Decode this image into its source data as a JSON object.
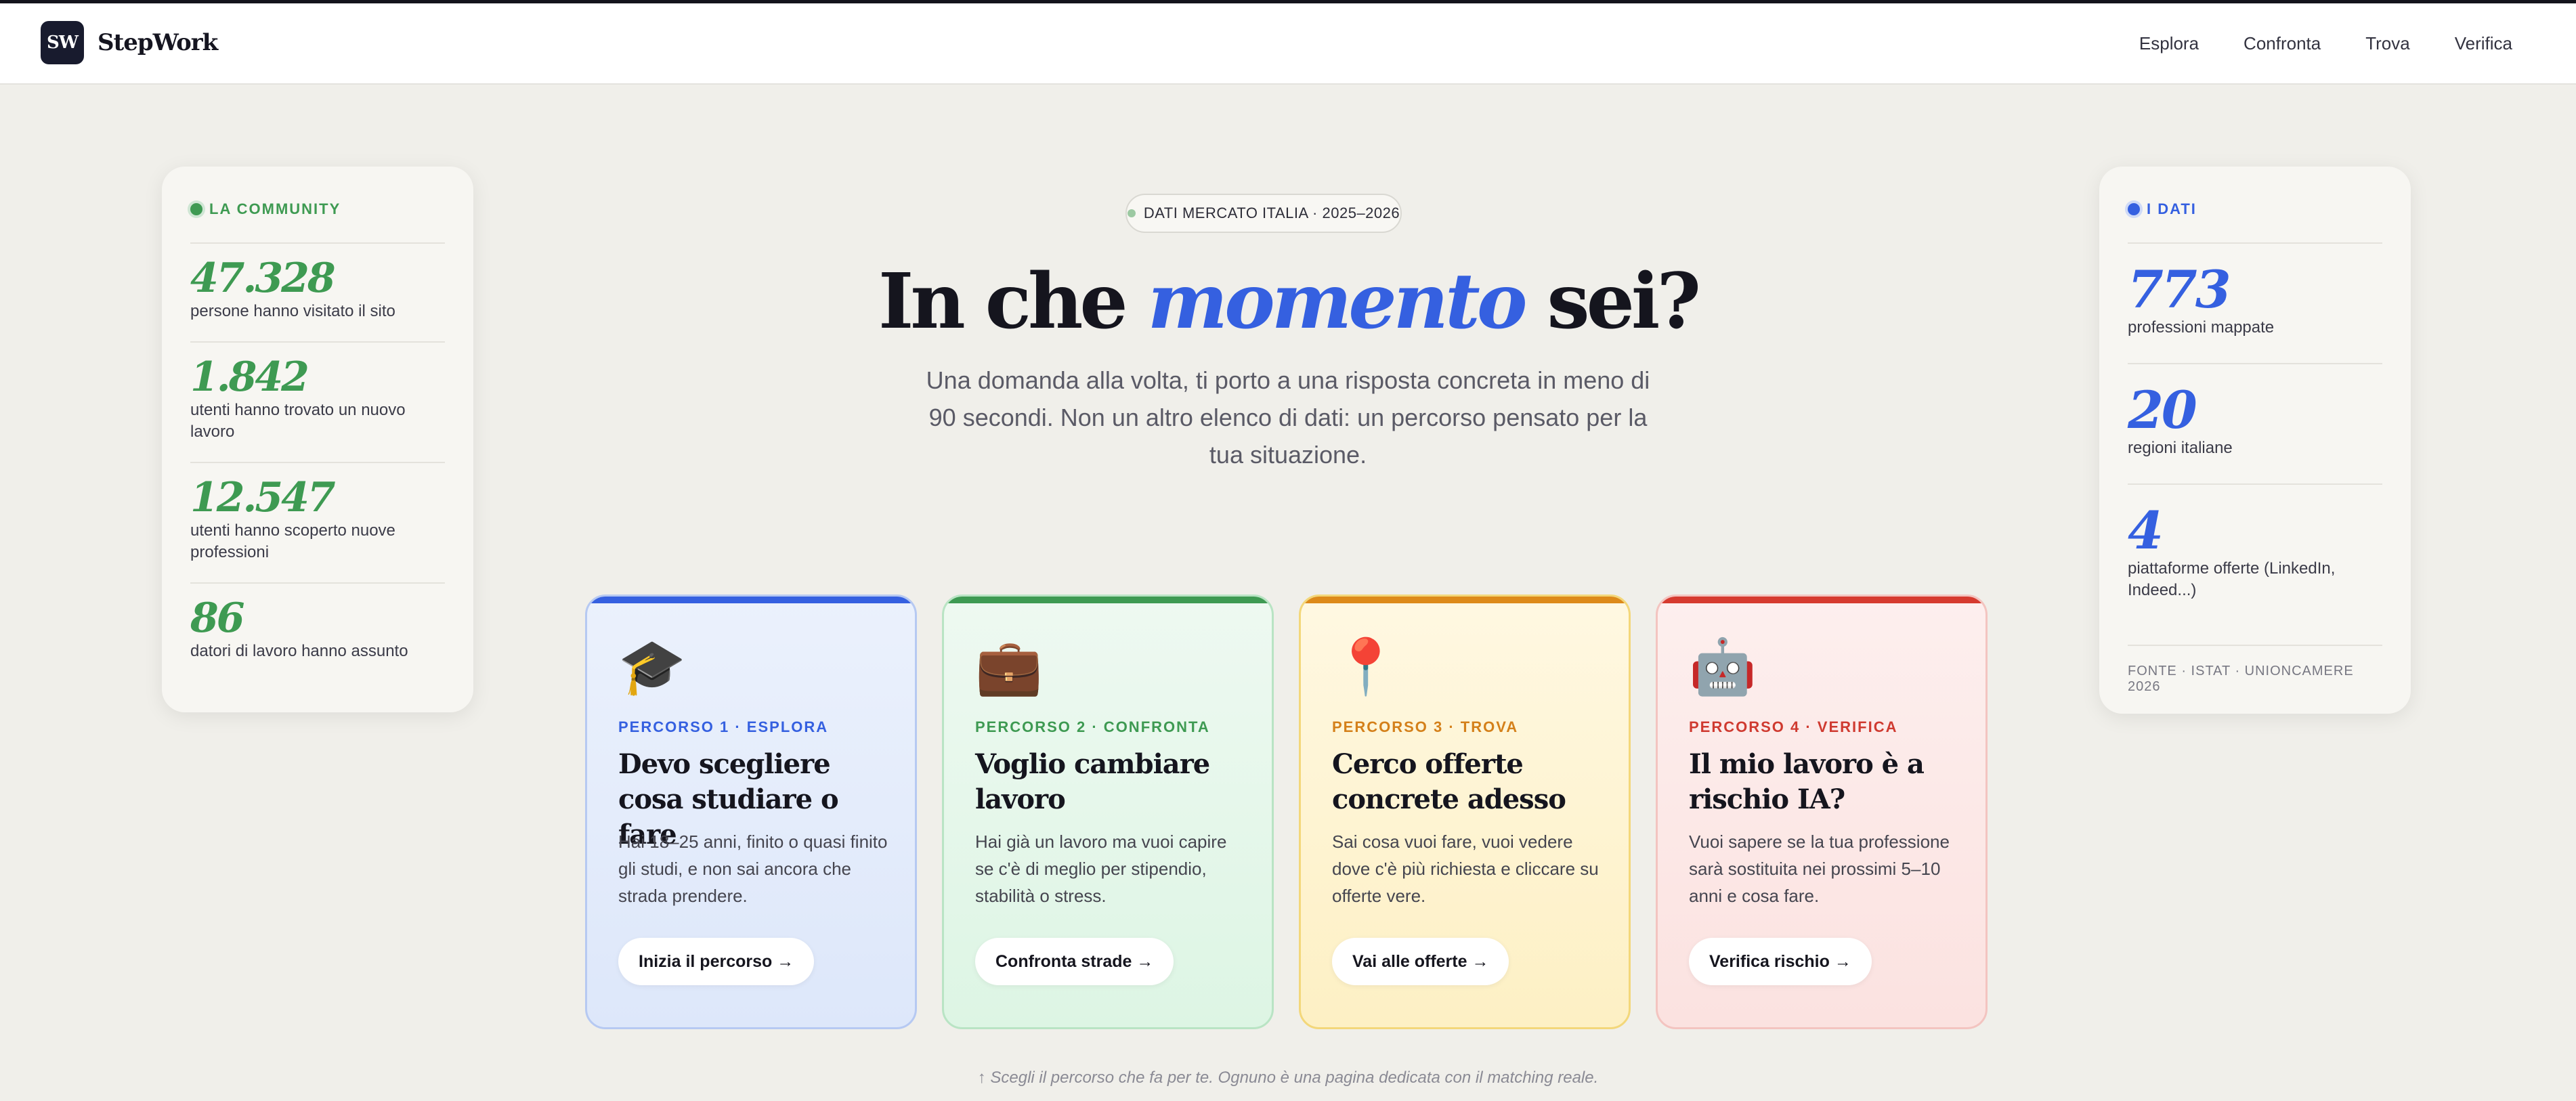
{
  "brand": {
    "logo_mark": "SW",
    "name": "StepWork"
  },
  "nav": [
    "Esplora",
    "Confronta",
    "Trova",
    "Verifica"
  ],
  "community": {
    "label": "LA COMMUNITY",
    "color": "#3e9a52",
    "stats": [
      {
        "num": "47.328",
        "desc": "persone hanno visitato il sito"
      },
      {
        "num": "1.842",
        "desc": "utenti hanno trovato un nuovo lavoro"
      },
      {
        "num": "12.547",
        "desc": "utenti hanno scoperto nuove professioni"
      },
      {
        "num": "86",
        "desc": "datori di lavoro hanno assunto"
      }
    ]
  },
  "data_panel": {
    "label": "I DATI",
    "color": "#3560e0",
    "stats": [
      {
        "num": "773",
        "desc": "professioni mappate"
      },
      {
        "num": "20",
        "desc": "regioni italiane"
      },
      {
        "num": "4",
        "desc": "piattaforme offerte (LinkedIn, Indeed...)"
      }
    ],
    "source": "FONTE · ISTAT · UNIONCAMERE 2026"
  },
  "hero": {
    "badge": "DATI MERCATO ITALIA · 2025–2026",
    "title_before": "In che ",
    "title_em": "momento",
    "title_after": " sei?",
    "lead": "Una domanda alla volta, ti porto a una risposta concreta in meno di 90 secondi. Non un altro elenco di dati: un percorso pensato per la tua situazione."
  },
  "cards": [
    {
      "icon": "graduation-cap-icon",
      "glyph": "🎓",
      "tag": "PERCORSO 1 · ESPLORA",
      "title": "Devo scegliere cosa studiare o fare",
      "desc": "Hai 18–25 anni, finito o quasi finito gli studi, e non sai ancora che strada prendere.",
      "button": "Inizia il percorso →",
      "accent": "#3560e0"
    },
    {
      "icon": "briefcase-icon",
      "glyph": "💼",
      "tag": "PERCORSO 2 · CONFRONTA",
      "title": "Voglio cambiare lavoro",
      "desc": "Hai già un lavoro ma vuoi capire se c'è di meglio per stipendio, stabilità o stress.",
      "button": "Confronta strade →",
      "accent": "#3e9a52"
    },
    {
      "icon": "pin-icon",
      "glyph": "📍",
      "tag": "PERCORSO 3 · TROVA",
      "title": "Cerco offerte concrete adesso",
      "desc": "Sai cosa vuoi fare, vuoi vedere dove c'è più richiesta e cliccare su offerte vere.",
      "button": "Vai alle offerte →",
      "accent": "#dd8a1a"
    },
    {
      "icon": "robot-icon",
      "glyph": "🤖",
      "tag": "PERCORSO 4 · VERIFICA",
      "title": "Il mio lavoro è a rischio IA?",
      "desc": "Vuoi sapere se la tua professione sarà sostituita nei prossimi 5–10 anni e cosa fare.",
      "button": "Verifica rischio →",
      "accent": "#d63a2f"
    }
  ],
  "footnote": "↑ Scegli il percorso che fa per te. Ognuno è una pagina dedicata con il matching reale."
}
